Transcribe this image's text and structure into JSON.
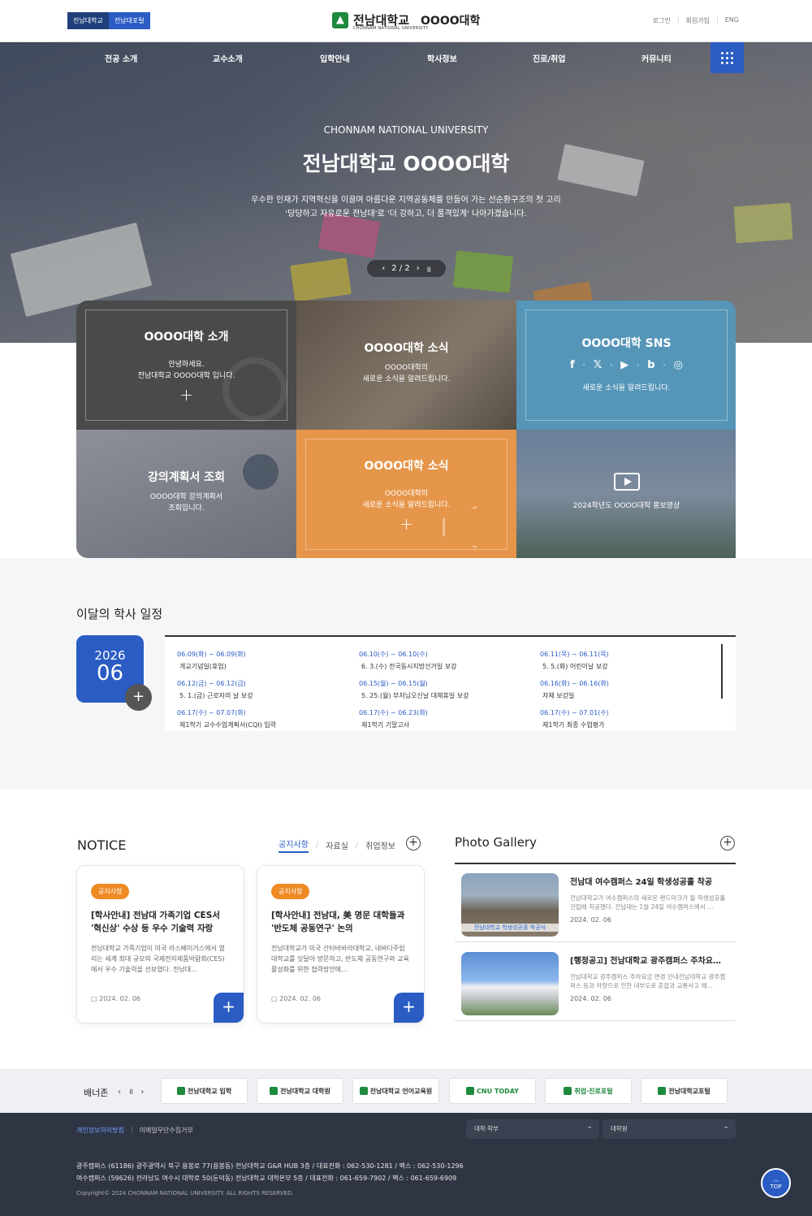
{
  "header": {
    "site_tabs": [
      "전남대학교",
      "전남대포털"
    ],
    "logo_main": "전남대학교",
    "logo_sub": "CHONNAM NATIONAL UNIVERSITY",
    "college": "OOOO대학",
    "util": [
      "로그인",
      "회원가입",
      "ENG"
    ]
  },
  "gnb": [
    "전공 소개",
    "교수소개",
    "입학안내",
    "학사정보",
    "진로/취업",
    "커뮤니티"
  ],
  "hero": {
    "eyebrow": "CHONNAM NATIONAL UNIVERSITY",
    "title": "전남대학교 OOOO대학",
    "desc1": "우수한 인재가 지역혁신을 이끌며 아름다운 지역공동체를 만들어 가는 선순환구조의 첫 고리",
    "desc2": "'당당하고 자유로운 전남대'로 '더 강하고, 더 품격있게' 나아가겠습니다.",
    "pager": "2 / 2"
  },
  "tiles": {
    "intro": {
      "title": "OOOO대학 소개",
      "desc1": "안녕하세요.",
      "desc2": "전남대학교 OOOO대학 입니다.",
      "plus": "+"
    },
    "news1": {
      "title": "OOOO대학 소식",
      "desc1": "OOOO대학의",
      "desc2": "새로운 소식을 알려드립니다."
    },
    "sns": {
      "title": "OOOO대학 SNS",
      "desc": "새로운 소식을 알려드립니다.",
      "icons": [
        "f",
        "𝕏",
        "▶",
        "b",
        "◎"
      ]
    },
    "syllabus": {
      "title": "강의계획서 조회",
      "desc1": "OOOO대학 강의계획서",
      "desc2": "조회입니다."
    },
    "news2": {
      "title": "OOOO대학 소식",
      "desc1": "OOOO대학의",
      "desc2": "새로운 소식을 알려드립니다.",
      "plus": "+"
    },
    "video": {
      "title": "2024학년도 OOOO대학 홍보영상"
    }
  },
  "schedule": {
    "title": "이달의 학사 일정",
    "year": "2026",
    "month": "06",
    "items": [
      {
        "date": "06.09(화) ~ 06.09(화)",
        "name": "개교기념일(휴업)"
      },
      {
        "date": "06.10(수) ~ 06.10(수)",
        "name": "6. 3.(수) 전국동시지방선거일 보강"
      },
      {
        "date": "06.11(목) ~ 06.11(목)",
        "name": "5. 5.(화) 어린이날 보강"
      },
      {
        "date": "06.12(금) ~ 06.12(금)",
        "name": "5. 1.(금) 근로자의 날 보강"
      },
      {
        "date": "06.15(월) ~ 06.15(월)",
        "name": "5. 25.(월) 부처님오신날 대체휴일 보강"
      },
      {
        "date": "06.16(화) ~ 06.16(화)",
        "name": "자체 보강일"
      },
      {
        "date": "06.17(수) ~ 07.07(화)",
        "name": "제1학기 교수수업계획서(CQI) 입력"
      },
      {
        "date": "06.17(수) ~ 06.23(화)",
        "name": "제1학기 기말고사"
      },
      {
        "date": "06.17(수) ~ 07.01(수)",
        "name": "제1학기 최종 수업평가"
      }
    ]
  },
  "notice": {
    "title": "NOTICE",
    "tabs": [
      "공지사항",
      "자료실",
      "취업정보"
    ],
    "cards": [
      {
        "badge": "공지사항",
        "title": "[학사안내] 전남대 가족기업 CES서 '혁신상' 수상 등 우수 기술력 자랑",
        "desc": "전남대학교 가족기업이 미국 라스베이거스에서 열리는 세계 최대 규모의 국제전자제품박람회(CES)에서 우수 기술력을 선보였다. 전남대…",
        "date": "2024. 02. 06"
      },
      {
        "badge": "공지사항",
        "title": "[학사안내] 전남대, 美 명문 대학들과 '반도체 공동연구' 논의",
        "desc": "전남대학교가 미국 산타바바라대학교, 네바다주립대학교를 잇달아 방문하고, 반도체 공동연구와 교육 활성화를 위한 협력방안에…",
        "date": "2024. 02. 06"
      }
    ]
  },
  "gallery": {
    "title": "Photo Gallery",
    "items": [
      {
        "title": "전남대 여수캠퍼스 24일 학생성공홀 착공",
        "desc": "전남대학교가 여수캠퍼스의 새로운 랜드마크가 될 학생성공홀 건립에 착공했다. 전남대는 1월 24일 여수캠퍼스에서 …",
        "date": "2024. 02. 06",
        "img_caption": "전남대학교 학생성공홀 착공식"
      },
      {
        "title": "[행정공고] 전남대학교 광주캠퍼스 주차요…",
        "desc": "전남대학교 광주캠퍼스 주차요금 변경 안내전남대학교 광주캠퍼스 등과 차량으로 인한 내부도로 혼잡과 교통사고 예…",
        "date": "2024. 02. 06"
      }
    ]
  },
  "banner": {
    "label": "배너존",
    "controls": "‹ ॥ ›",
    "logos": [
      "전남대학교 입학",
      "전남대학교 대학원",
      "전남대학교 언어교육원",
      "CNU TODAY",
      "취업·진로포털",
      "전남대학교포털"
    ]
  },
  "footer": {
    "privacy": "개인정보처리방침",
    "email": "이메일무단수집거부",
    "select1": "대학·학부",
    "select2": "대학원",
    "addr1": "광주캠퍼스 (61186) 광주광역시 북구 용봉로 77(용봉동) 전남대학교 G&R HUB 3층 / 대표전화 : 062-530-1281 / 팩스 : 062-530-1296",
    "addr2": "여수캠퍼스 (59626) 전라남도 여수시 대학로 50(둔덕동) 전남대학교 대학본부 5층 / 대표전화 : 061-659-7902 / 팩스 : 061-659-6909",
    "copyright": "Copyright© 2024 CHONNAM NATIONAL UNIVERSITY. ALL RIGHTS RESERVED.",
    "top": "TOP"
  }
}
